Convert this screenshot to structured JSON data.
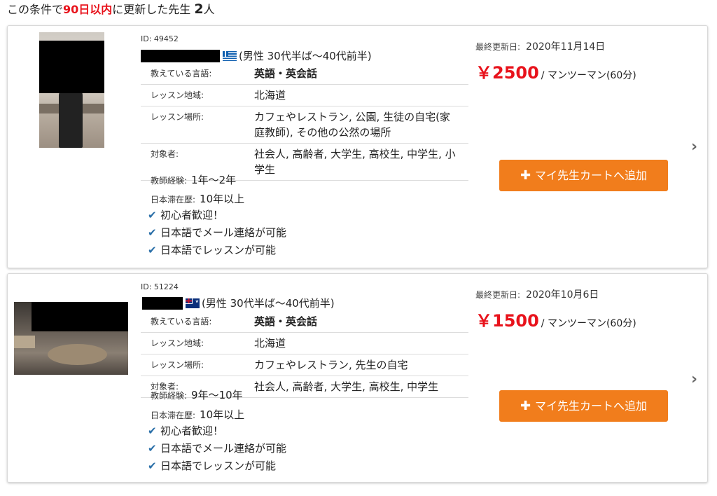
{
  "summary": {
    "prefix": "この条件で",
    "highlight": "90日以内",
    "middle": "に更新した先生 ",
    "count": "2",
    "suffix": "人"
  },
  "teachers": [
    {
      "id_text": "ID: 49452",
      "flag": "greece-flag",
      "gender_age": "(男性 30代半ば〜40代前半)",
      "details": [
        {
          "label": "教えている言語:",
          "value": "英語・英会話"
        },
        {
          "label": "レッスン地域:",
          "value": "北海道"
        },
        {
          "label": "レッスン場所:",
          "value": "カフェやレストラン, 公園, 生徒の自宅(家庭教師), その他の公然の場所"
        },
        {
          "label": "対象者:",
          "value": "社会人, 高齢者, 大学生, 高校生, 中学生, 小学生"
        }
      ],
      "experience_label": "教師経験:",
      "experience": "1年〜2年",
      "stay_label": "日本滞在歴:",
      "stay": "10年以上",
      "features": [
        "初心者歓迎！",
        "日本語でメール連絡が可能",
        "日本語でレッスンが可能"
      ],
      "updated_label": "最終更新日:",
      "updated": "2020年11月14日",
      "price": "￥2500",
      "price_unit": "/ マンツーマン(60分)",
      "cart_label": "マイ先生カートへ追加"
    },
    {
      "id_text": "ID: 51224",
      "flag": "australia-flag",
      "gender_age": "(男性 30代半ば〜40代前半)",
      "details": [
        {
          "label": "教えている言語:",
          "value": "英語・英会話"
        },
        {
          "label": "レッスン地域:",
          "value": "北海道"
        },
        {
          "label": "レッスン場所:",
          "value": "カフェやレストラン, 先生の自宅"
        },
        {
          "label": "対象者:",
          "value": "社会人, 高齢者, 大学生, 高校生, 中学生"
        }
      ],
      "experience_label": "教師経験:",
      "experience": "9年〜10年",
      "stay_label": "日本滞在歴:",
      "stay": "10年以上",
      "features": [
        "初心者歓迎！",
        "日本語でメール連絡が可能",
        "日本語でレッスンが可能"
      ],
      "updated_label": "最終更新日:",
      "updated": "2020年10月6日",
      "price": "￥1500",
      "price_unit": "/ マンツーマン(60分)",
      "cart_label": "マイ先生カートへ追加"
    }
  ],
  "icons": {
    "check": "✔",
    "plus": "✚",
    "chevron": "›"
  }
}
